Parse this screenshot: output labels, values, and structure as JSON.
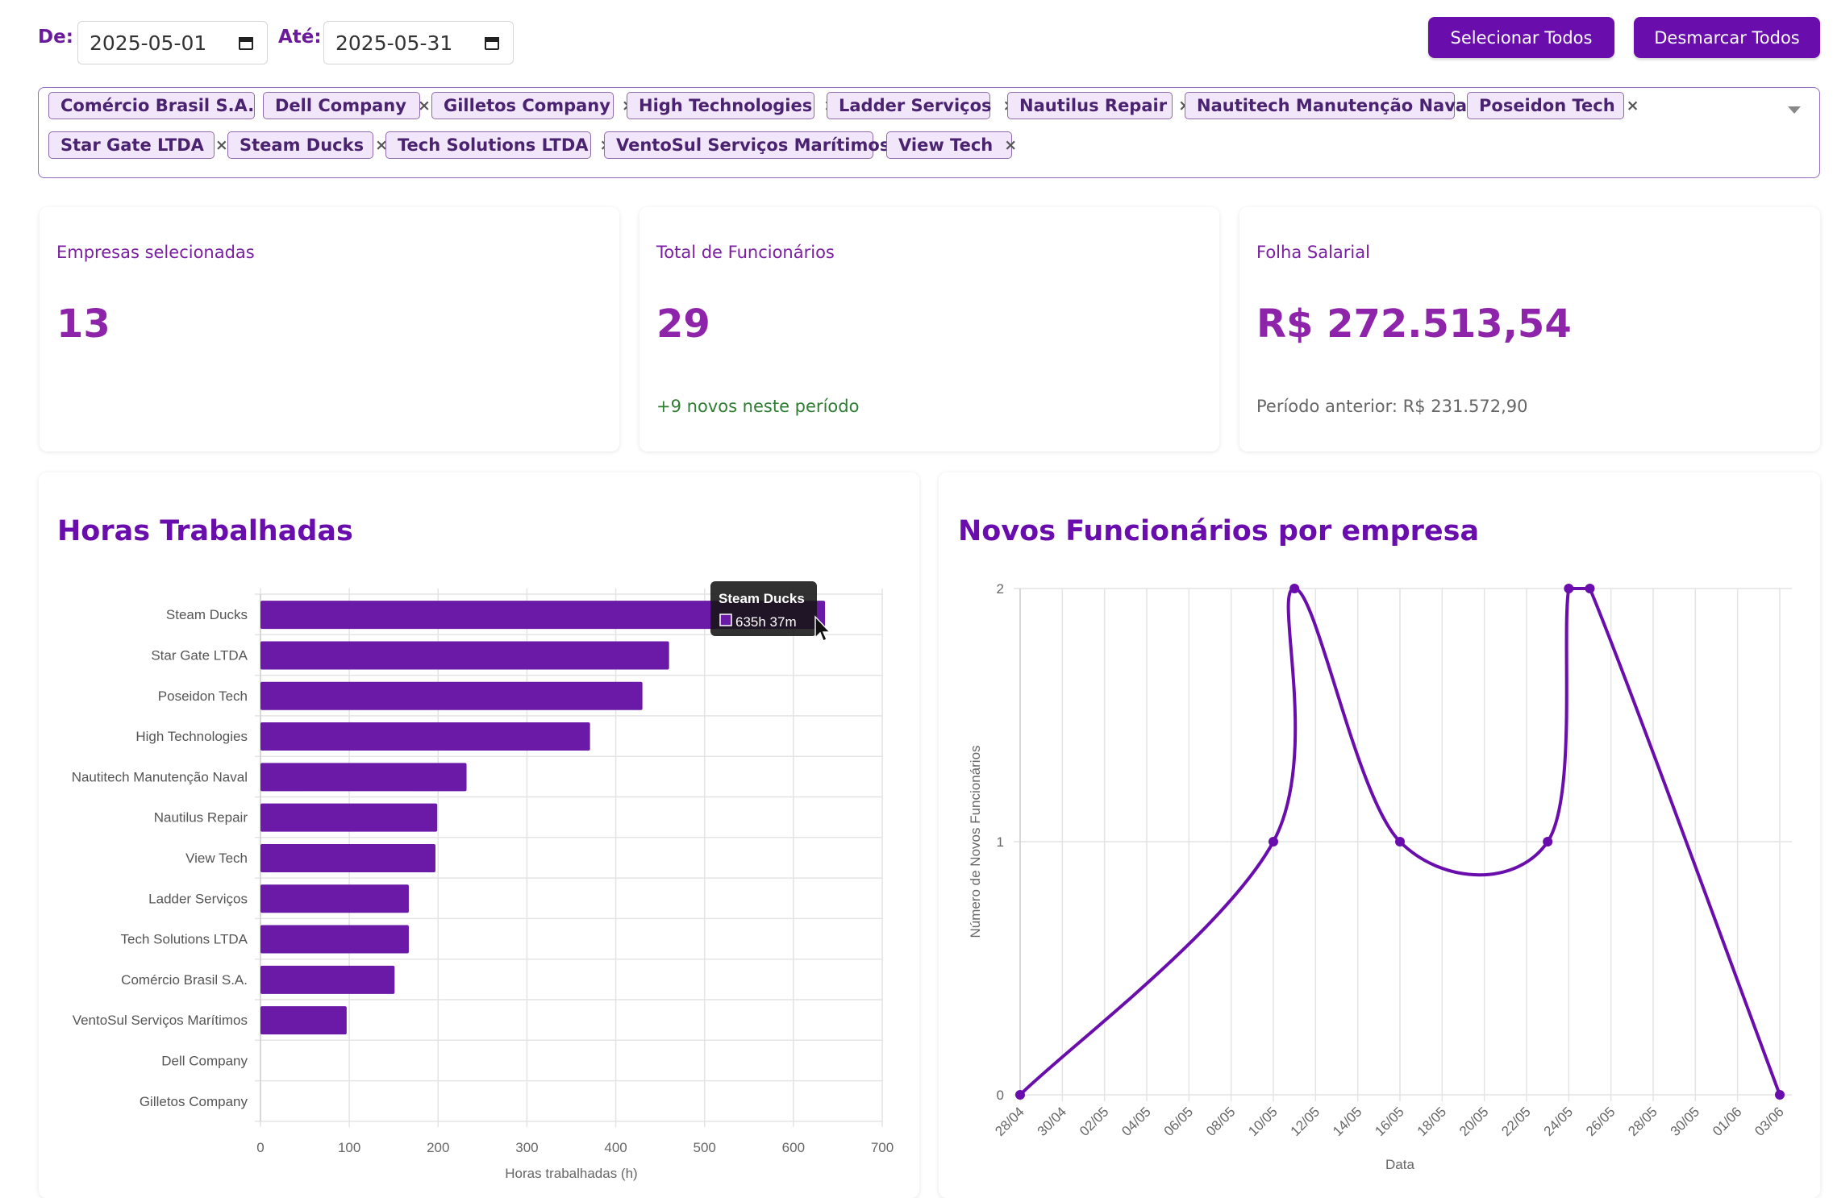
{
  "filters": {
    "from_label": "De:",
    "from_value": "2025-05-01",
    "to_label": "Até:",
    "to_value": "2025-05-31",
    "select_all_label": "Selecionar Todos",
    "deselect_all_label": "Desmarcar Todos"
  },
  "selected_companies": [
    "Comércio Brasil S.A.",
    "Dell Company",
    "Gilletos Company",
    "High Technologies",
    "Ladder Serviços",
    "Nautilus Repair",
    "Nautitech Manutenção Naval",
    "Poseidon Tech",
    "Star Gate LTDA",
    "Steam Ducks",
    "Tech Solutions LTDA",
    "VentoSul Serviços Marítimos",
    "View Tech"
  ],
  "chip_remove_glyph": "×",
  "cards": {
    "companies": {
      "title": "Empresas selecionadas",
      "value": "13"
    },
    "employees": {
      "title": "Total de Funcionários",
      "value": "29",
      "sub": "+9 novos neste período"
    },
    "payroll": {
      "title": "Folha Salarial",
      "value": "R$ 272.513,54",
      "sub": "Período anterior: R$ 231.572,90"
    }
  },
  "colors": {
    "accent": "#6a0dad",
    "bar": "#6a1aa6",
    "positive": "#2e7d32",
    "muted": "#666666"
  },
  "hours_panel": {
    "title": "Horas Trabalhadas"
  },
  "new_employees_panel": {
    "title": "Novos Funcionários por empresa"
  },
  "chart_data": [
    {
      "type": "bar",
      "orientation": "horizontal",
      "title": "Horas Trabalhadas",
      "categories": [
        "Steam Ducks",
        "Star Gate LTDA",
        "Poseidon Tech",
        "High Technologies",
        "Nautitech Manutenção Naval",
        "Nautilus Repair",
        "View Tech",
        "Ladder Serviços",
        "Tech Solutions LTDA",
        "Comércio Brasil S.A.",
        "VentoSul Serviços Marítimos",
        "Dell Company",
        "Gilletos Company"
      ],
      "values": [
        635.6,
        460,
        430,
        371,
        232,
        199,
        197,
        167,
        167,
        151,
        97,
        0,
        0
      ],
      "xlabel": "Horas trabalhadas (h)",
      "xlim": [
        0,
        700
      ],
      "xticks": [
        0,
        100,
        200,
        300,
        400,
        500,
        600,
        700
      ],
      "grid": true,
      "tooltip": {
        "title": "Steam Ducks",
        "value": "635h 37m"
      }
    },
    {
      "type": "line",
      "title": "Novos Funcionários por empresa",
      "x": [
        "28/04",
        "10/05",
        "11/05",
        "16/05",
        "23/05",
        "24/05",
        "25/05",
        "03/06"
      ],
      "values": [
        0,
        1,
        2,
        1,
        1,
        2,
        2,
        0
      ],
      "xticks": [
        "28/04",
        "30/04",
        "02/05",
        "04/05",
        "06/05",
        "08/05",
        "10/05",
        "12/05",
        "14/05",
        "16/05",
        "18/05",
        "20/05",
        "22/05",
        "24/05",
        "26/05",
        "28/05",
        "30/05",
        "01/06",
        "03/06"
      ],
      "yticks": [
        "0",
        "1",
        "2"
      ],
      "ylim": [
        0,
        2
      ],
      "xlabel": "Data",
      "ylabel": "Número de Novos Funcionários",
      "grid": true
    }
  ]
}
